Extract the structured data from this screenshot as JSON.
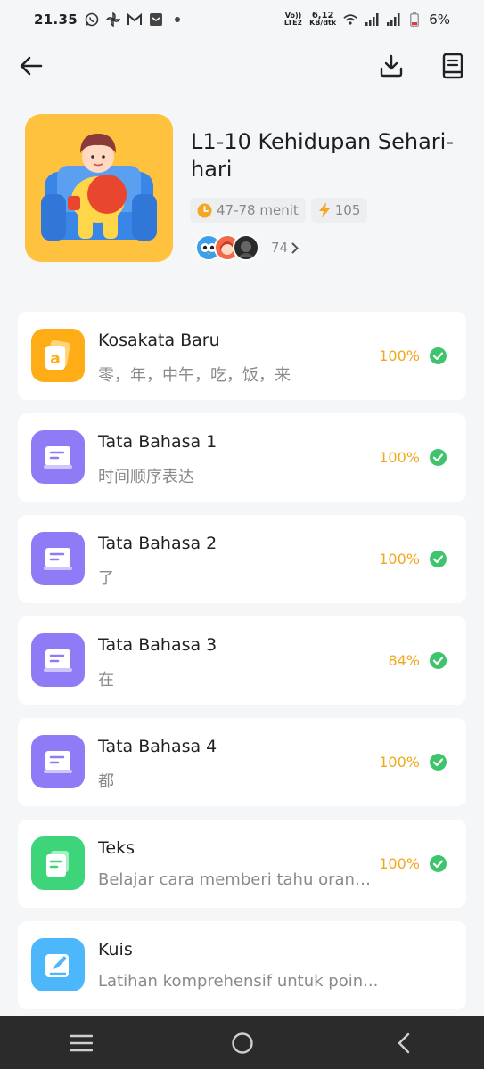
{
  "status_bar": {
    "time": "21.35",
    "net_line1": "6,12",
    "net_line2": "KB/dtk",
    "lte_line1": "Vo))",
    "lte_line2": "LTE2",
    "battery": "6%",
    "icons": [
      "whatsapp-icon",
      "pinwheel-icon",
      "gmail-icon",
      "inbox-icon",
      "dot-icon",
      "wifi-icon",
      "signal-icon",
      "battery-icon"
    ]
  },
  "nav": {
    "back_icon": "arrow-left-icon",
    "download_icon": "download-icon",
    "book_icon": "book-icon"
  },
  "lesson": {
    "title": "L1-10 Kehidupan Sehari-hari",
    "duration": "47-78 menit",
    "xp": "105",
    "learner_count": "74"
  },
  "items": [
    {
      "title": "Kosakata Baru",
      "subtitle": "零，年，中午，吃，饭，来",
      "progress": "100%",
      "icon": "vocab-card-icon",
      "color": "#ffad17"
    },
    {
      "title": "Tata Bahasa 1",
      "subtitle": "时间顺序表达",
      "progress": "100%",
      "icon": "grammar-book-icon",
      "color": "#8f7bf5"
    },
    {
      "title": "Tata Bahasa 2",
      "subtitle": "了",
      "progress": "100%",
      "icon": "grammar-book-icon",
      "color": "#8f7bf5"
    },
    {
      "title": "Tata Bahasa 3",
      "subtitle": "在",
      "progress": "84%",
      "icon": "grammar-book-icon",
      "color": "#8f7bf5"
    },
    {
      "title": "Tata Bahasa 4",
      "subtitle": "都",
      "progress": "100%",
      "icon": "grammar-book-icon",
      "color": "#8f7bf5"
    },
    {
      "title": "Teks",
      "subtitle": "Belajar cara memberi tahu orang l...",
      "progress": "100%",
      "icon": "text-document-icon",
      "color": "#3dd47a"
    },
    {
      "title": "Kuis",
      "subtitle": "Latihan komprehensif untuk poin...",
      "progress": "",
      "icon": "quiz-pencil-icon",
      "color": "#4cb8fb"
    }
  ],
  "colors": {
    "accent": "#f2a81c",
    "check": "#3ec46d",
    "background": "#f5f6f7"
  },
  "system_nav": [
    "menu-icon",
    "home-icon",
    "back-chevron-icon"
  ]
}
